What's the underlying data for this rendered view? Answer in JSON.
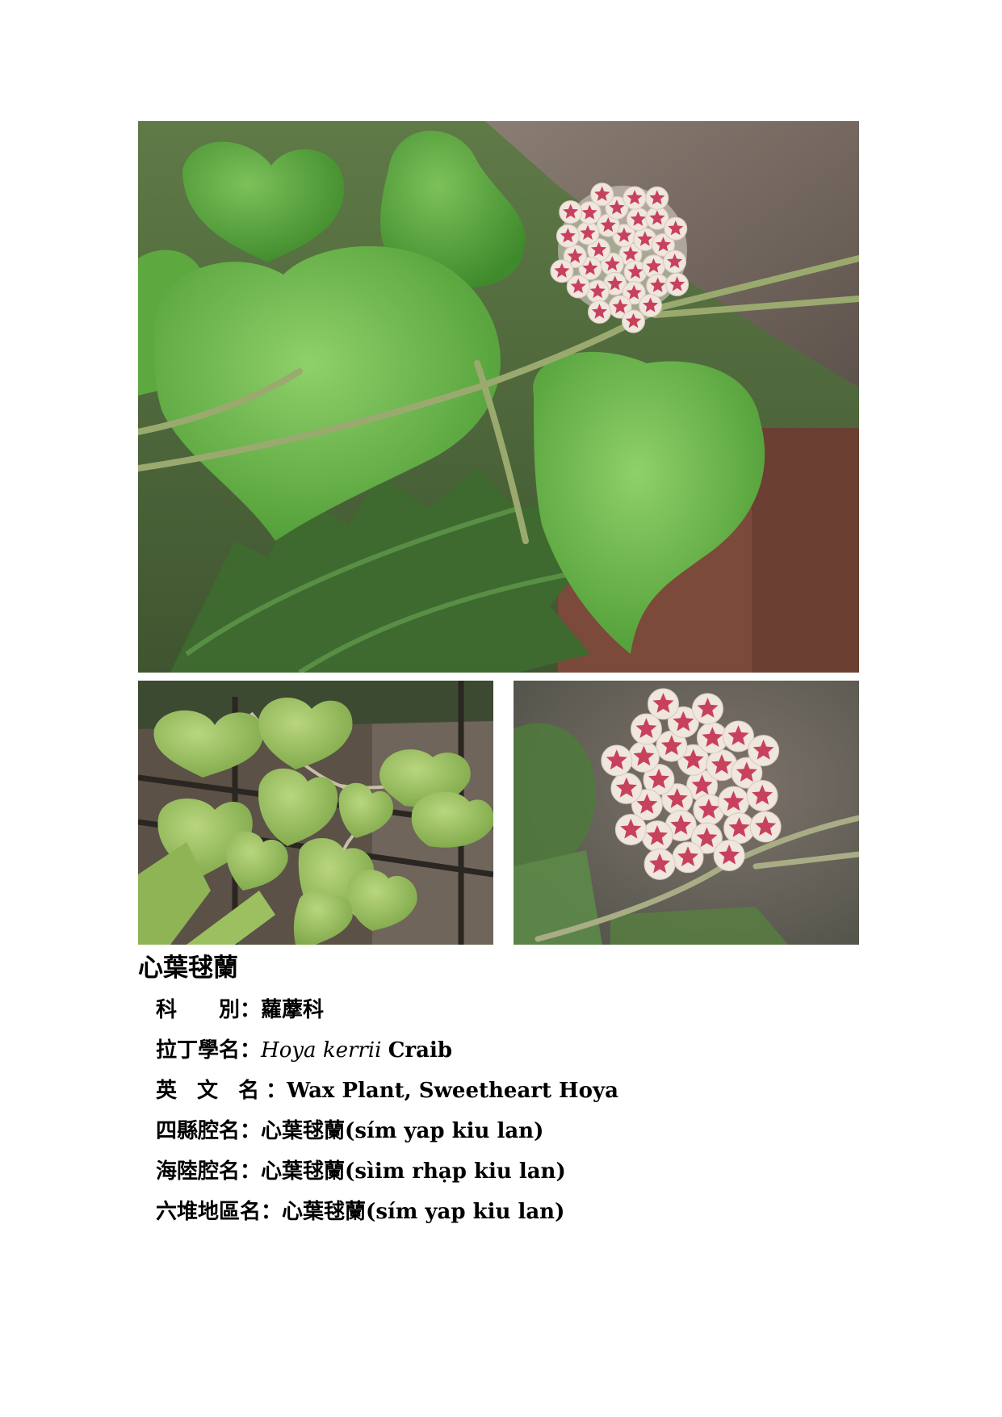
{
  "title": "心葉毬蘭",
  "info": {
    "family": {
      "label": "科　　別",
      "colon": "：",
      "value": "蘿藦科"
    },
    "latin": {
      "label": "拉丁學名",
      "colon": "：",
      "genus_species": "Hoya kerrii",
      "author": "Craib"
    },
    "english": {
      "label": "英 文 名",
      "colon": "：",
      "value": "Wax Plant, Sweetheart Hoya"
    },
    "sixian": {
      "label": "四縣腔名",
      "colon": "：",
      "name": "心葉毬蘭",
      "romanization": "(sím yap kiu lan)"
    },
    "hailu": {
      "label": "海陸腔名",
      "colon": "：",
      "name": "心葉毬蘭",
      "romanization": "(sìim rhạp kiu lan)"
    },
    "liudui": {
      "label": "六堆地區名",
      "colon": "：",
      "name": "心葉毬蘭",
      "romanization": "(sím yap kiu lan)"
    }
  },
  "colors": {
    "leaf": "#6fb84a",
    "leaf_dark": "#4e9a35",
    "rock": "#7a6d64",
    "flower_white": "#efe6de",
    "flower_red": "#c8415c"
  }
}
